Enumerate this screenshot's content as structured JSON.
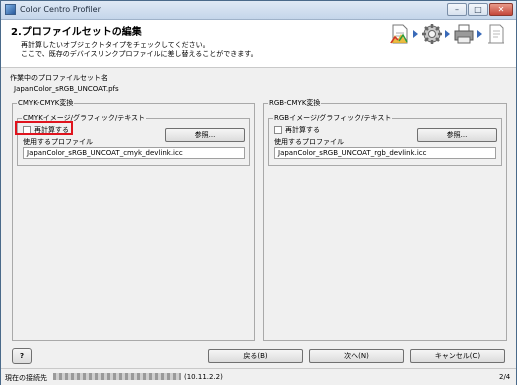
{
  "window": {
    "title": "Color Centro Profiler",
    "minimize": "–",
    "restore": "□",
    "close": "✕"
  },
  "header": {
    "title": "2.プロファイルセットの編集",
    "desc_line1": "再計算したいオブジェクトタイプをチェックしてください。",
    "desc_line2": "ここで、既存のデバイスリンクプロファイルに差し替えることができます。",
    "steps": [
      "document-icon",
      "gear-icon",
      "printer-icon",
      "finish-icon"
    ]
  },
  "profile_set": {
    "label": "作業中のプロファイルセット名",
    "name": "JapanColor_sRGB_UNCOAT.pfs"
  },
  "cmyk": {
    "group_title": "CMYK-CMYK変換",
    "sub_title": "CMYKイメージ/グラフィック/テキスト",
    "recalc_label": "再計算する",
    "recalc_checked": false,
    "browse_label": "参照...",
    "profile_label": "使用するプロファイル",
    "profile_value": "JapanColor_sRGB_UNCOAT_cmyk_devlink.icc"
  },
  "rgb": {
    "group_title": "RGB-CMYK変換",
    "sub_title": "RGBイメージ/グラフィック/テキスト",
    "recalc_label": "再計算する",
    "recalc_checked": false,
    "browse_label": "参照...",
    "profile_label": "使用するプロファイル",
    "profile_value": "JapanColor_sRGB_UNCOAT_rgb_devlink.icc"
  },
  "footer": {
    "help_label": "?",
    "back_label": "戻る(B)",
    "next_label": "次へ(N)",
    "cancel_label": "キャンセル(C)"
  },
  "status": {
    "connection_label": "現在の接続先",
    "ip_suffix": "(10.11.2.2)",
    "page": "2/4"
  },
  "colors": {
    "highlight": "#e0141e",
    "title_bar": "#c4d5ea",
    "step_arrow": "#3a6ab8"
  }
}
